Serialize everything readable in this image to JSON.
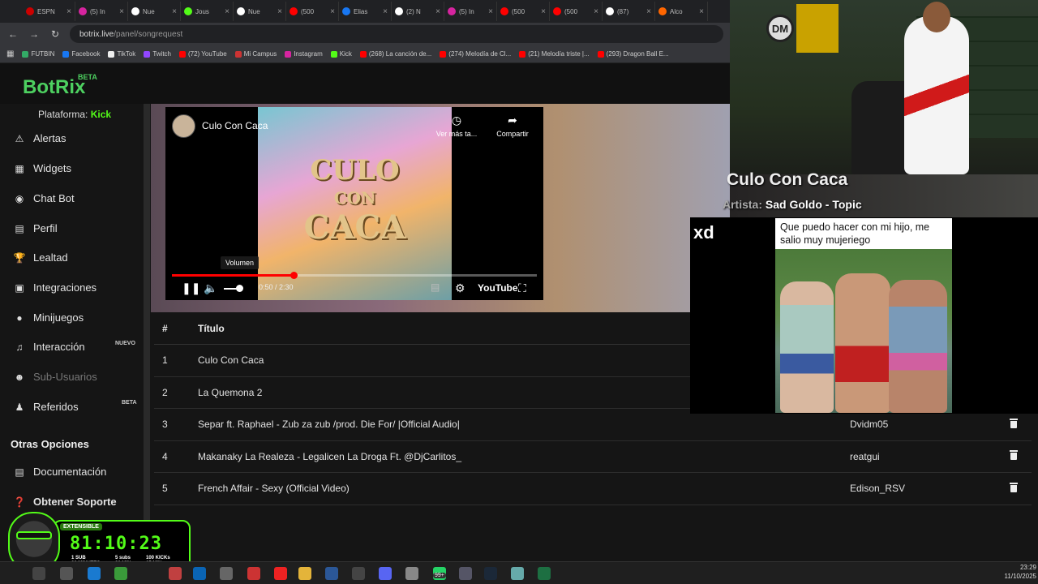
{
  "browser": {
    "tabs": [
      {
        "label": "ESPN",
        "color": "#c00"
      },
      {
        "label": "(5) In",
        "color": "#d6249f"
      },
      {
        "label": "Nue",
        "color": "#fff"
      },
      {
        "label": "Jous",
        "color": "#53fc18"
      },
      {
        "label": "Nue",
        "color": "#fff"
      },
      {
        "label": "(500",
        "color": "#f00"
      },
      {
        "label": "Elias",
        "color": "#1877f2"
      },
      {
        "label": "(2) N",
        "color": "#fff"
      },
      {
        "label": "(5) In",
        "color": "#d6249f"
      },
      {
        "label": "(500",
        "color": "#f00"
      },
      {
        "label": "(500",
        "color": "#f00"
      },
      {
        "label": "(87)",
        "color": "#fff"
      },
      {
        "label": "Alco",
        "color": "#f60"
      }
    ],
    "url_host": "botrix.live",
    "url_path": "/panel/songrequest",
    "bookmarks": [
      {
        "label": "FUTBIN",
        "color": "#3a6"
      },
      {
        "label": "Facebook",
        "color": "#1877f2"
      },
      {
        "label": "TikTok",
        "color": "#eee"
      },
      {
        "label": "Twitch",
        "color": "#9146ff"
      },
      {
        "label": "(72) YouTube",
        "color": "#f00"
      },
      {
        "label": "Mi Campus",
        "color": "#c33"
      },
      {
        "label": "Instagram",
        "color": "#d6249f"
      },
      {
        "label": "Kick",
        "color": "#53fc18"
      },
      {
        "label": "(268) La canción de...",
        "color": "#f00"
      },
      {
        "label": "(274) Melodía de Cl...",
        "color": "#f00"
      },
      {
        "label": "(21) Melodía triste |...",
        "color": "#f00"
      },
      {
        "label": "(293) Dragon Ball E...",
        "color": "#f00"
      }
    ]
  },
  "app": {
    "logo": "BotRix",
    "beta": "BETA",
    "platform_label": "Plataforma:",
    "platform_value": "Kick"
  },
  "sidebar": {
    "items": [
      {
        "label": "Alertas",
        "icon": "alert-icon"
      },
      {
        "label": "Widgets",
        "icon": "widgets-icon"
      },
      {
        "label": "Chat Bot",
        "icon": "robot-icon"
      },
      {
        "label": "Perfil",
        "icon": "profile-card-icon"
      },
      {
        "label": "Lealtad",
        "icon": "trophy-icon"
      },
      {
        "label": "Integraciones",
        "icon": "integrations-icon"
      },
      {
        "label": "Minijuegos",
        "icon": "gamepad-icon"
      },
      {
        "label": "Interacción",
        "icon": "music-icon"
      },
      {
        "label": "Sub-Usuarios",
        "icon": "users-icon"
      },
      {
        "label": "Referidos",
        "icon": "referral-icon"
      }
    ],
    "badge_nuevo": "NUEVO",
    "badge_beta": "BETA",
    "other_title": "Otras Opciones",
    "other_items": [
      {
        "label": "Documentación",
        "icon": "document-icon"
      },
      {
        "label": "Obtener Soporte",
        "icon": "help-icon"
      }
    ]
  },
  "player": {
    "title": "Culo Con Caca",
    "thumb_line1": "CULO",
    "thumb_line2": "CON",
    "thumb_line3": "CACA",
    "watch_later": "Ver más ta...",
    "share": "Compartir",
    "volume_tooltip": "Volumen",
    "time": "0:50 / 2:30",
    "progress": 0.333,
    "volume": 0.75,
    "youtube_label": "YouTube"
  },
  "table": {
    "col_num": "#",
    "col_title": "Título",
    "rows": [
      {
        "num": "1",
        "title": "Culo Con Caca",
        "user": ""
      },
      {
        "num": "2",
        "title": "La Quemona 2",
        "user": ""
      },
      {
        "num": "3",
        "title": "Separ ft. Raphael - Zub za zub /prod. Die For/ |Official Audio|",
        "user": "Dvidm05"
      },
      {
        "num": "4",
        "title": "Makanaky La Realeza - Legalicen La Droga Ft. @DjCarlitos_",
        "user": "reatgui"
      },
      {
        "num": "5",
        "title": "French Affair - Sexy (Official Video)",
        "user": "Edison_RSV"
      }
    ]
  },
  "overlay": {
    "song_title": "Culo Con Caca",
    "artist_label": "Artista:",
    "artist": "Sad Goldo - Topic",
    "meme_xd": "xd",
    "meme_caption": "Que puedo hacer con mi hijo, me salio muy mujeriego",
    "cam_badge": "DM",
    "timer_ext": "EXTENSIBLE",
    "timer": "81:10:23",
    "timer_sub1": "1 SUB\n30 MINUTES",
    "timer_sub2": "5 subs\n20 MIN",
    "timer_sub3": "100 KICKs\n15 MIN"
  },
  "taskbar": {
    "time": "23:29",
    "date": "11/10/2025",
    "notif_count": "99+"
  }
}
